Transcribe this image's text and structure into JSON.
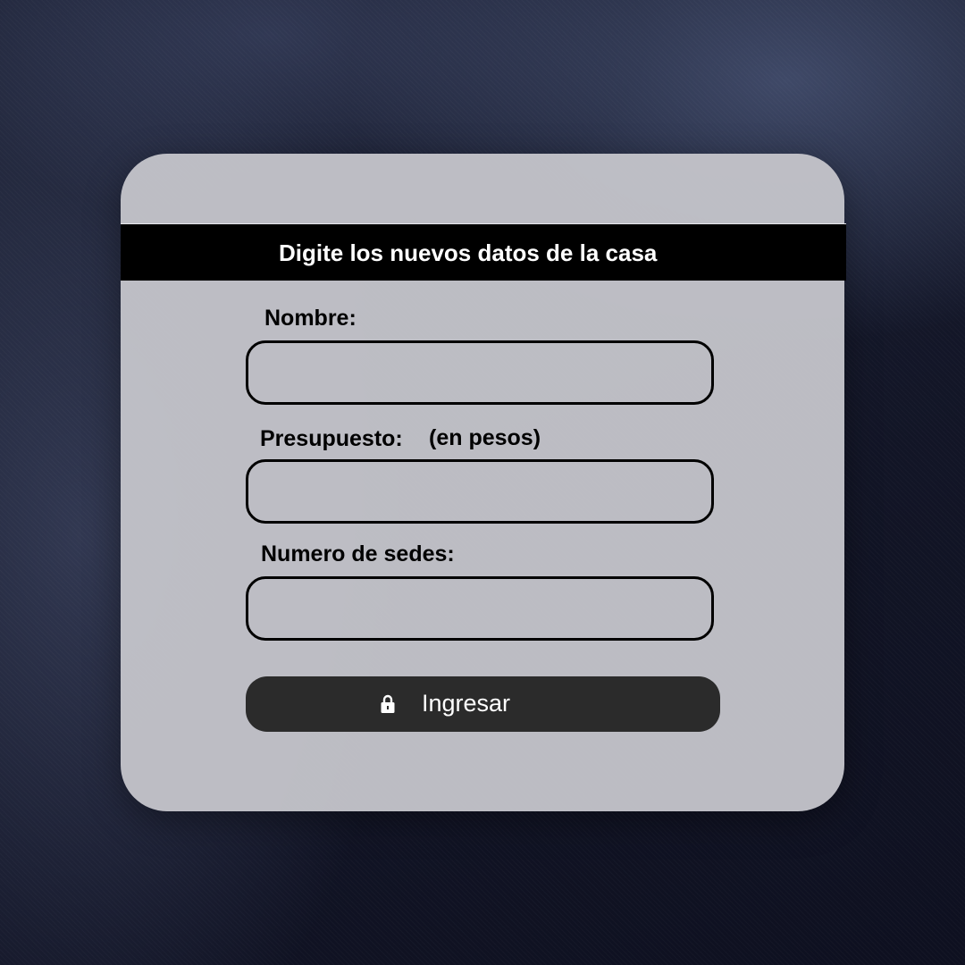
{
  "form": {
    "title": "Digite los nuevos datos de la casa",
    "fields": [
      {
        "label": "Nombre:",
        "value": ""
      },
      {
        "label": "Presupuesto:",
        "hint": "(en pesos)",
        "value": ""
      },
      {
        "label": "Numero de sedes:",
        "value": ""
      }
    ],
    "submit": {
      "label": "Ingresar",
      "icon": "lock-icon"
    }
  },
  "colors": {
    "card": "#c4c4ca",
    "banner": "#000000",
    "button": "#2b2b2b",
    "background": "#161a2c"
  }
}
